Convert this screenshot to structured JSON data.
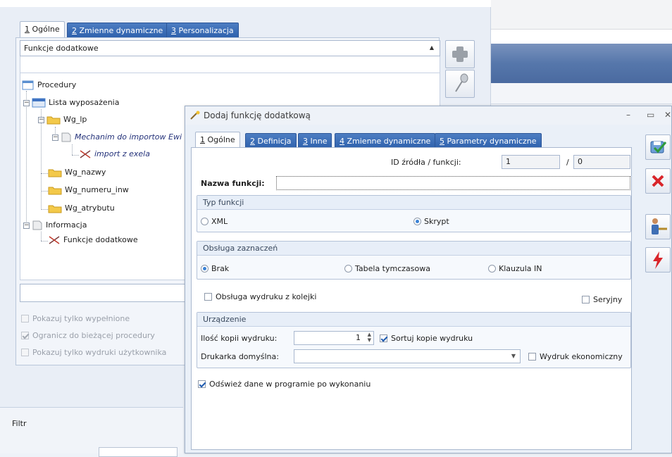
{
  "background": {
    "tabs": [
      {
        "num": "1",
        "label": "Ogólne"
      },
      {
        "num": "2",
        "label": "Zmienne dynamiczne"
      },
      {
        "num": "3",
        "label": "Personalizacja"
      }
    ],
    "combo_label": "Funkcje dodatkowe",
    "tree": [
      {
        "label": "Procedury"
      },
      {
        "label": "Lista wyposażenia"
      },
      {
        "label": "Wg_lp"
      },
      {
        "label": "Mechanim do importow Ewi"
      },
      {
        "label": "import z exela"
      },
      {
        "label": "Wg_nazwy"
      },
      {
        "label": "Wg_numeru_inw"
      },
      {
        "label": "Wg_atrybutu"
      },
      {
        "label": "Informacja"
      },
      {
        "label": "Funkcje dodatkowe"
      }
    ],
    "options": [
      {
        "label": "Pokazuj tylko wypełnione",
        "checked": false
      },
      {
        "label": "Ogranicz do bieżącej procedury",
        "checked": true
      },
      {
        "label": "Pokazuj tylko wydruki użytkownika",
        "checked": false
      }
    ],
    "filter_label": "Filtr",
    "side_buttons": [
      "plus-icon",
      "pin-icon"
    ]
  },
  "dialog": {
    "title": "Dodaj funkcję dodatkową",
    "window_controls": [
      "–",
      "▭",
      "✕"
    ],
    "tabs": [
      {
        "num": "1",
        "label": "Ogólne"
      },
      {
        "num": "2",
        "label": "Definicja"
      },
      {
        "num": "3",
        "label": "Inne"
      },
      {
        "num": "4",
        "label": "Zmienne dynamiczne"
      },
      {
        "num": "5",
        "label": "Parametry dynamiczne"
      }
    ],
    "id_label": "ID źródła / funkcji:",
    "id_value": "1",
    "id_sep": "/",
    "func_value": "0",
    "name_label": "Nazwa funkcji:",
    "name_value": "",
    "typ_group": {
      "title": "Typ funkcji",
      "options": [
        {
          "label": "XML",
          "selected": false
        },
        {
          "label": "Skrypt",
          "selected": true
        }
      ]
    },
    "obsluga_group": {
      "title": "Obsługa zaznaczeń",
      "options": [
        {
          "label": "Brak",
          "selected": true
        },
        {
          "label": "Tabela tymczasowa",
          "selected": false
        },
        {
          "label": "Klauzula IN",
          "selected": false
        }
      ]
    },
    "queue_label": "Obsługa wydruku z kolejki",
    "queue_checked": false,
    "serial_label": "Seryjny",
    "serial_checked": false,
    "device_group": {
      "title": "Urządzenie",
      "copies_label": "Ilość kopii wydruku:",
      "copies_value": "1",
      "sort_label": "Sortuj kopie wydruku",
      "sort_checked": true,
      "printer_label": "Drukarka domyślna:",
      "printer_value": "",
      "economic_label": "Wydruk ekonomiczny",
      "economic_checked": false
    },
    "refresh_label": "Odśwież dane w programie po wykonaniu",
    "refresh_checked": true,
    "action_buttons": [
      "save-icon",
      "cancel-icon",
      "user-key-icon",
      "lightning-icon"
    ]
  },
  "colors": {
    "tab_blue": "#3a6db7",
    "title_band": "#5677ab",
    "radio_on": "#3b82d6",
    "cancel_red": "#d9252a"
  }
}
